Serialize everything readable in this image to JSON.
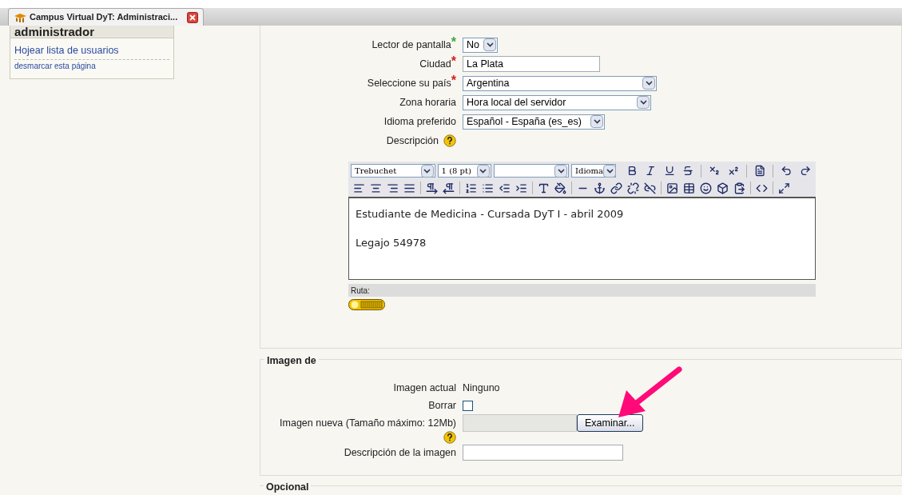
{
  "tab": {
    "title": "Campus Virtual DyT: Administraci..."
  },
  "sidebar": {
    "heading": "administrador",
    "links": [
      {
        "text": "Hojear lista de usuarios",
        "kind": "primary"
      },
      {
        "text": "desmarcar esta página",
        "kind": "secondary"
      }
    ]
  },
  "profile_form": {
    "fields": [
      {
        "kind": "select",
        "label": "Lector de pantalla",
        "marker": {
          "text": "*",
          "color": "#3aa83a"
        },
        "value": "No"
      },
      {
        "kind": "text",
        "label": "Ciudad",
        "marker": {
          "text": "*",
          "color": "#d42020"
        },
        "value": "La Plata"
      },
      {
        "kind": "select",
        "label": "Seleccione su país",
        "marker": {
          "text": "*",
          "color": "#d42020"
        },
        "value": "Argentina"
      },
      {
        "kind": "select",
        "label": "Zona horaria",
        "value": "Hora local del servidor"
      },
      {
        "kind": "select",
        "label": "Idioma preferido",
        "value": "Español - España (es_es)"
      },
      {
        "kind": "help",
        "label": "Descripción"
      }
    ],
    "editor": {
      "selects": [
        {
          "kind": "font",
          "value": "Trebuchet"
        },
        {
          "kind": "size",
          "value": "1 (8 pt)"
        },
        {
          "kind": "format"
        },
        {
          "kind": "language",
          "value": "Idioma"
        }
      ],
      "paragraphs": [
        "Estudiante de Medicina - Cursada DyT I - abril 2009",
        "Legajo 54978"
      ],
      "path_label": "Ruta:"
    }
  },
  "image_section": {
    "legend": "Imagen de",
    "rows": [
      {
        "kind": "value",
        "label": "Imagen actual",
        "value": "Ninguno"
      },
      {
        "kind": "checkbox",
        "label": "Borrar",
        "checked": false
      },
      {
        "kind": "file",
        "label": "Imagen nueva (Tamaño máximo: 12Mb)",
        "button": "Examinar..."
      },
      {
        "kind": "input",
        "label": "Descripción de la imagen"
      }
    ]
  },
  "next_section": {
    "legend": "Opcional"
  }
}
